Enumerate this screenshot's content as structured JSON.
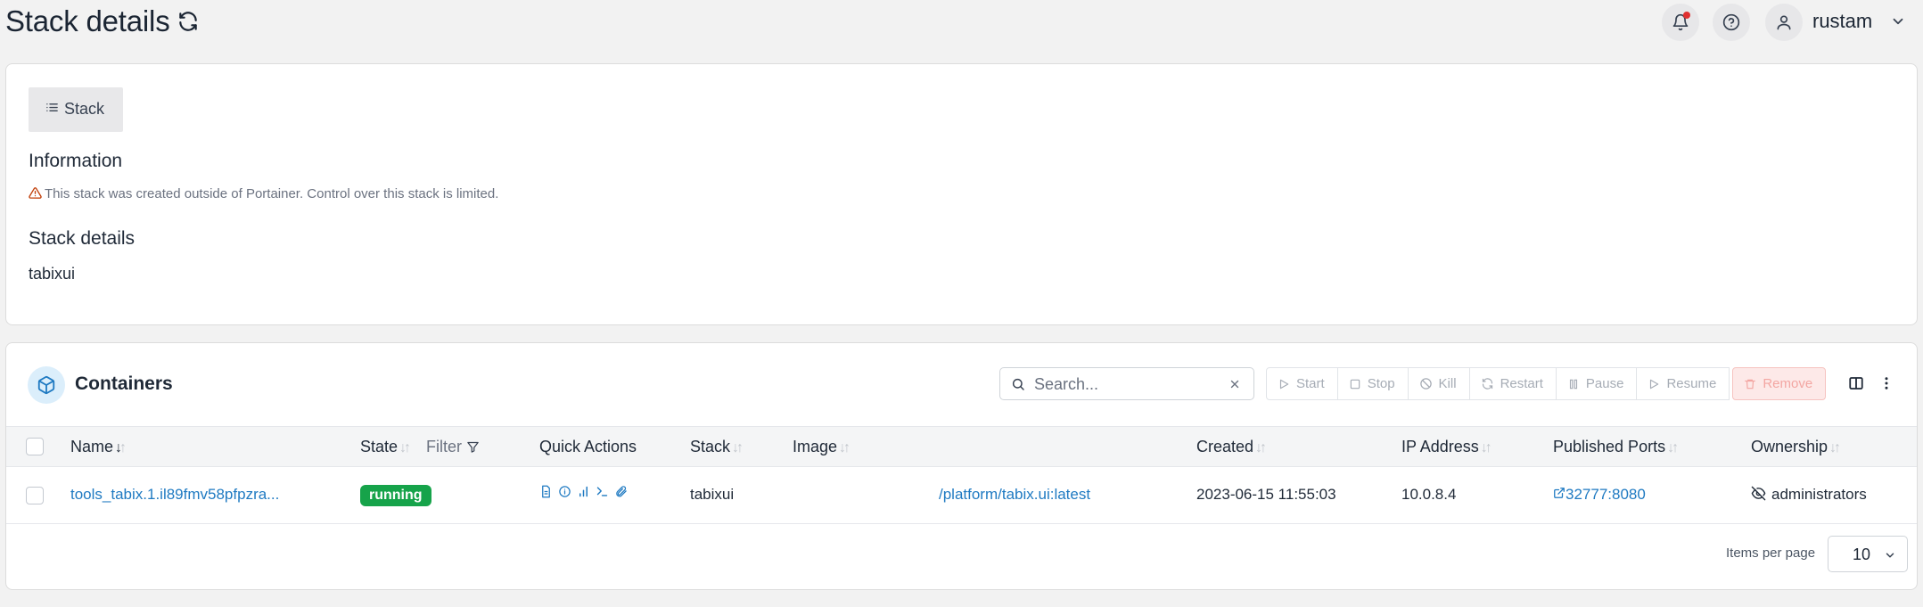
{
  "header": {
    "title": "Stack details",
    "username": "rustam"
  },
  "stack_card": {
    "tab_label": "Stack",
    "info_heading": "Information",
    "warning_text": "This stack was created outside of Portainer. Control over this stack is limited.",
    "details_heading": "Stack details",
    "stack_name": "tabixui"
  },
  "containers": {
    "title": "Containers",
    "search_placeholder": "Search...",
    "actions": {
      "start": "Start",
      "stop": "Stop",
      "kill": "Kill",
      "restart": "Restart",
      "pause": "Pause",
      "resume": "Resume",
      "remove": "Remove"
    },
    "columns": {
      "name": "Name",
      "state": "State",
      "filter": "Filter",
      "quick_actions": "Quick Actions",
      "stack": "Stack",
      "image": "Image",
      "created": "Created",
      "ip_address": "IP Address",
      "published_ports": "Published Ports",
      "ownership": "Ownership"
    },
    "rows": [
      {
        "name": "tools_tabix.1.il89fmv58pfpzra...",
        "state": "running",
        "stack": "tabixui",
        "image": "/platform/tabix.ui:latest",
        "created": "2023-06-15 11:55:03",
        "ip": "10.0.8.4",
        "ports": "32777:8080",
        "ownership": "administrators"
      }
    ],
    "items_per_page_label": "Items per page",
    "items_per_page_value": "10"
  },
  "colors": {
    "accent": "#1f7ac2",
    "running": "#16a34a",
    "danger": "#f3a6a2",
    "warning": "#c2410c"
  }
}
